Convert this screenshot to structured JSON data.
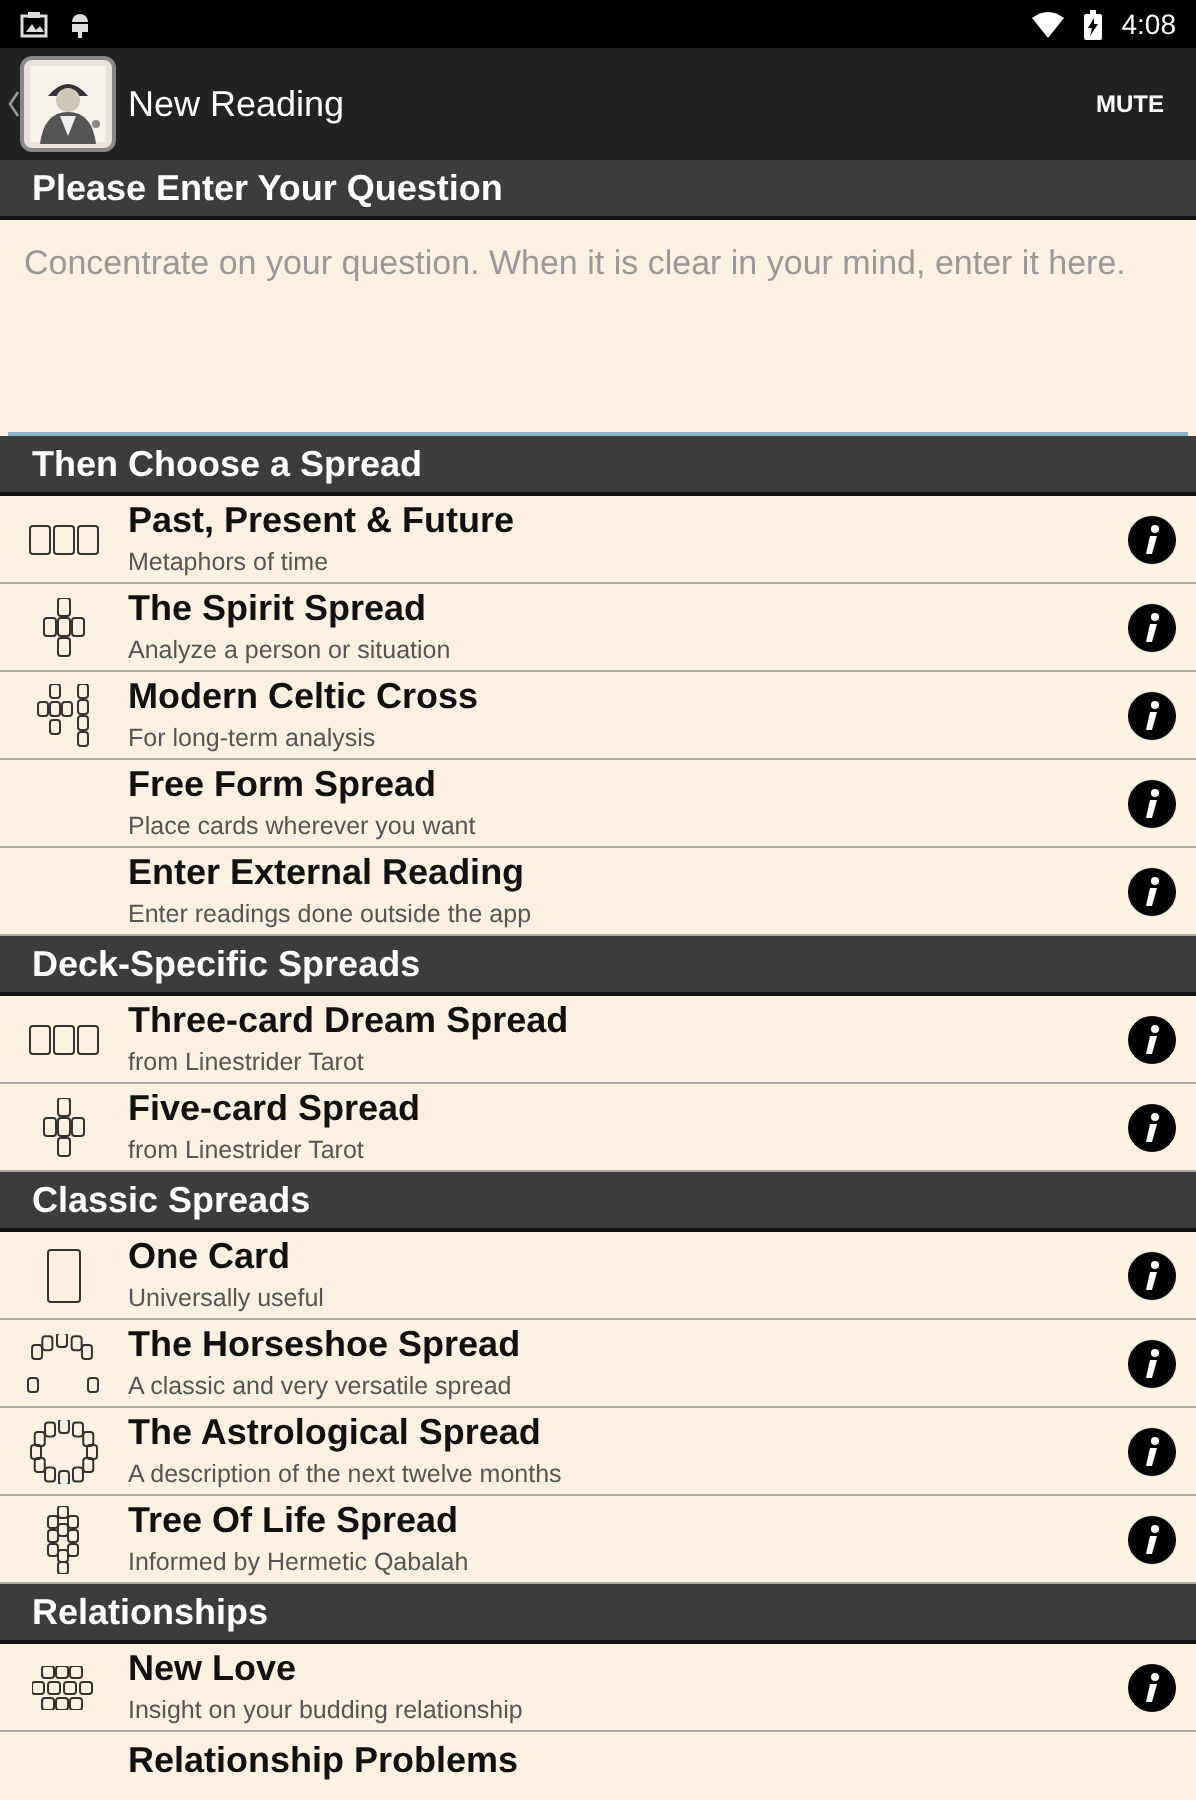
{
  "status_bar": {
    "time": "4:08"
  },
  "app_bar": {
    "title": "New Reading",
    "action": "MUTE"
  },
  "question": {
    "heading": "Please Enter Your Question",
    "placeholder": "Concentrate on your question. When it is clear in your mind, enter it here."
  },
  "sections": [
    {
      "heading": "Then Choose a Spread",
      "spreads": [
        {
          "title": "Past, Present & Future",
          "subtitle": "Metaphors of time",
          "kind": "three"
        },
        {
          "title": "The Spirit Spread",
          "subtitle": "Analyze a person or situation",
          "kind": "cross"
        },
        {
          "title": "Modern Celtic Cross",
          "subtitle": "For long-term analysis",
          "kind": "celtic"
        },
        {
          "title": "Free Form Spread",
          "subtitle": "Place cards wherever you want",
          "kind": "none"
        },
        {
          "title": "Enter External Reading",
          "subtitle": "Enter readings done outside the app",
          "kind": "none"
        }
      ]
    },
    {
      "heading": "Deck-Specific Spreads",
      "spreads": [
        {
          "title": "Three-card Dream Spread",
          "subtitle": "from Linestrider Tarot",
          "kind": "three"
        },
        {
          "title": "Five-card Spread",
          "subtitle": "from Linestrider Tarot",
          "kind": "cross"
        }
      ]
    },
    {
      "heading": "Classic Spreads",
      "spreads": [
        {
          "title": "One Card",
          "subtitle": "Universally useful",
          "kind": "one"
        },
        {
          "title": "The Horseshoe Spread",
          "subtitle": "A classic and very versatile spread",
          "kind": "horseshoe"
        },
        {
          "title": "The Astrological Spread",
          "subtitle": "A description of the next twelve months",
          "kind": "astro"
        },
        {
          "title": "Tree Of Life Spread",
          "subtitle": "Informed by Hermetic Qabalah",
          "kind": "tree"
        }
      ]
    },
    {
      "heading": "Relationships",
      "spreads": [
        {
          "title": "New Love",
          "subtitle": "Insight on your budding relationship",
          "kind": "love"
        },
        {
          "title": "Relationship Problems",
          "kind": "none"
        }
      ]
    }
  ]
}
